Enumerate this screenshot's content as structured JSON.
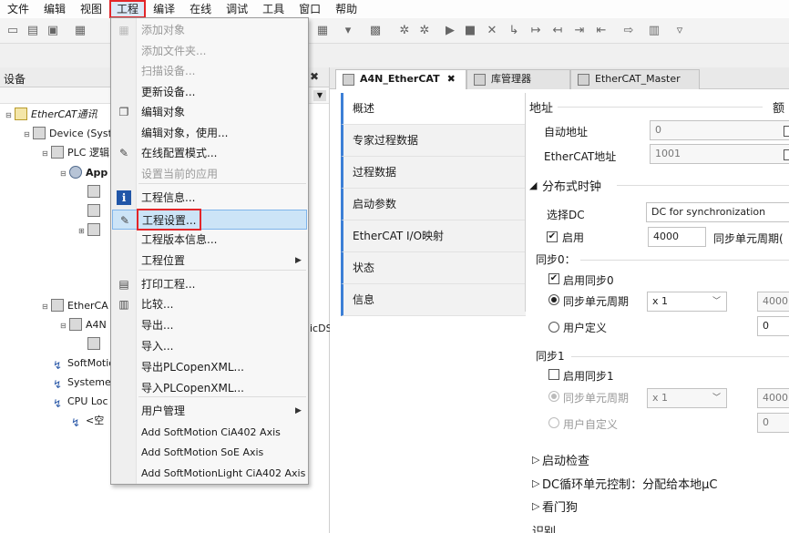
{
  "menubar": [
    {
      "label": "文件"
    },
    {
      "label": "编辑"
    },
    {
      "label": "视图"
    },
    {
      "label": "工程",
      "active": true
    },
    {
      "label": "编译"
    },
    {
      "label": "在线"
    },
    {
      "label": "调试"
    },
    {
      "label": "工具"
    },
    {
      "label": "窗口"
    },
    {
      "label": "帮助"
    }
  ],
  "device_panel": {
    "title": "设备",
    "tree": [
      {
        "label": "EtherCAT通讯",
        "icon": "project-icon"
      },
      {
        "label": "Device (Syst",
        "icon": "device-icon"
      },
      {
        "label": "PLC 逻辑",
        "icon": "plc-logic-icon"
      },
      {
        "label": "App",
        "icon": "application-gear-icon"
      },
      {
        "label": "",
        "icon": "library-icon"
      },
      {
        "label": "",
        "icon": "task-icon"
      },
      {
        "label": "",
        "icon": "gvl-icon"
      },
      {
        "label": "EtherCA",
        "icon": "ethercat-master-icon"
      },
      {
        "label": "A4N",
        "icon": "drive-icon"
      },
      {
        "label": "",
        "icon": "axis-icon"
      },
      {
        "label": "SoftMotio",
        "icon": "softmotion-link-icon"
      },
      {
        "label": "Systeme",
        "icon": "link-icon"
      },
      {
        "label": "CPU Loc",
        "icon": "cpu-link-icon"
      },
      {
        "label": "<空",
        "icon": "empty-slot-icon"
      }
    ],
    "behind_text": "icDS"
  },
  "project_menu": {
    "items": [
      {
        "label": "添加对象",
        "disabled": true,
        "icon": "add-object-icon"
      },
      {
        "label": "添加文件夹...",
        "disabled": true,
        "icon": "add-folder-icon"
      },
      {
        "label": "扫描设备...",
        "disabled": true,
        "icon": ""
      },
      {
        "label": "更新设备...",
        "disabled": false,
        "icon": ""
      },
      {
        "label": "编辑对象",
        "disabled": false,
        "icon": "edit-object-icon"
      },
      {
        "label": "编辑对象，使用...",
        "disabled": false,
        "icon": ""
      },
      {
        "label": "在线配置模式...",
        "disabled": false,
        "icon": "online-config-icon"
      },
      {
        "label": "设置当前的应用",
        "disabled": true,
        "icon": ""
      },
      {
        "label": "工程信息...",
        "disabled": false,
        "icon": "info-icon"
      },
      {
        "label": "工程设置...",
        "disabled": false,
        "icon": "settings-icon",
        "hover": true
      },
      {
        "label": "工程版本信息...",
        "disabled": false,
        "icon": ""
      },
      {
        "label": "工程位置",
        "disabled": false,
        "icon": "",
        "submenu": true
      },
      {
        "label": "打印工程...",
        "disabled": false,
        "icon": "print-icon"
      },
      {
        "label": "比较...",
        "disabled": false,
        "icon": "compare-icon"
      },
      {
        "label": "导出...",
        "disabled": false,
        "icon": ""
      },
      {
        "label": "导入...",
        "disabled": false,
        "icon": ""
      },
      {
        "label": "导出PLCopenXML...",
        "disabled": false,
        "icon": ""
      },
      {
        "label": "导入PLCopenXML...",
        "disabled": false,
        "icon": ""
      },
      {
        "label": "用户管理",
        "disabled": false,
        "icon": "",
        "submenu": true
      },
      {
        "label": "Add SoftMotion CiA402 Axis",
        "disabled": false,
        "icon": "",
        "en": true
      },
      {
        "label": "Add SoftMotion SoE Axis",
        "disabled": false,
        "icon": "",
        "en": true
      },
      {
        "label": "Add SoftMotionLight CiA402 Axis",
        "disabled": false,
        "icon": "",
        "en": true
      }
    ]
  },
  "editor": {
    "tabs": [
      {
        "label": "A4N_EtherCAT",
        "active": true,
        "close": "✖"
      },
      {
        "label": "库管理器",
        "active": false
      },
      {
        "label": "EtherCAT_Master",
        "active": false
      }
    ],
    "side_tabs": [
      "概述",
      "专家过程数据",
      "过程数据",
      "启动参数",
      "EtherCAT I/O映射",
      "状态",
      "信息"
    ],
    "address": {
      "heading": "地址",
      "right_heading": "额",
      "auto_label": "自动地址",
      "auto_value": "0",
      "ecat_label": "EtherCAT地址",
      "ecat_value": "1001"
    },
    "dc": {
      "heading": "分布式时钟",
      "select_label": "选择DC",
      "select_value": "DC for synchronization",
      "enable_label": "启用",
      "enable_checked": true,
      "cycle_value": "4000",
      "cycle_label": "同步单元周期("
    },
    "sync0": {
      "heading": "同步0：",
      "enable_label": "启用同步0",
      "enable_checked": true,
      "unit_label": "同步单元周期",
      "unit_value": "x 1",
      "unit_result": "4000",
      "user_label": "用户定义",
      "user_value": "0"
    },
    "sync1": {
      "heading": "同步1",
      "enable_label": "启用同步1",
      "enable_checked": false,
      "unit_label": "同步单元周期",
      "unit_value": "x 1",
      "unit_result": "4000",
      "user_label": "用户自定义",
      "user_value": "0"
    },
    "collapsed_sections": [
      "启动检查",
      "DC循环单元控制：分配给本地μC",
      "看门狗",
      "识别"
    ]
  }
}
